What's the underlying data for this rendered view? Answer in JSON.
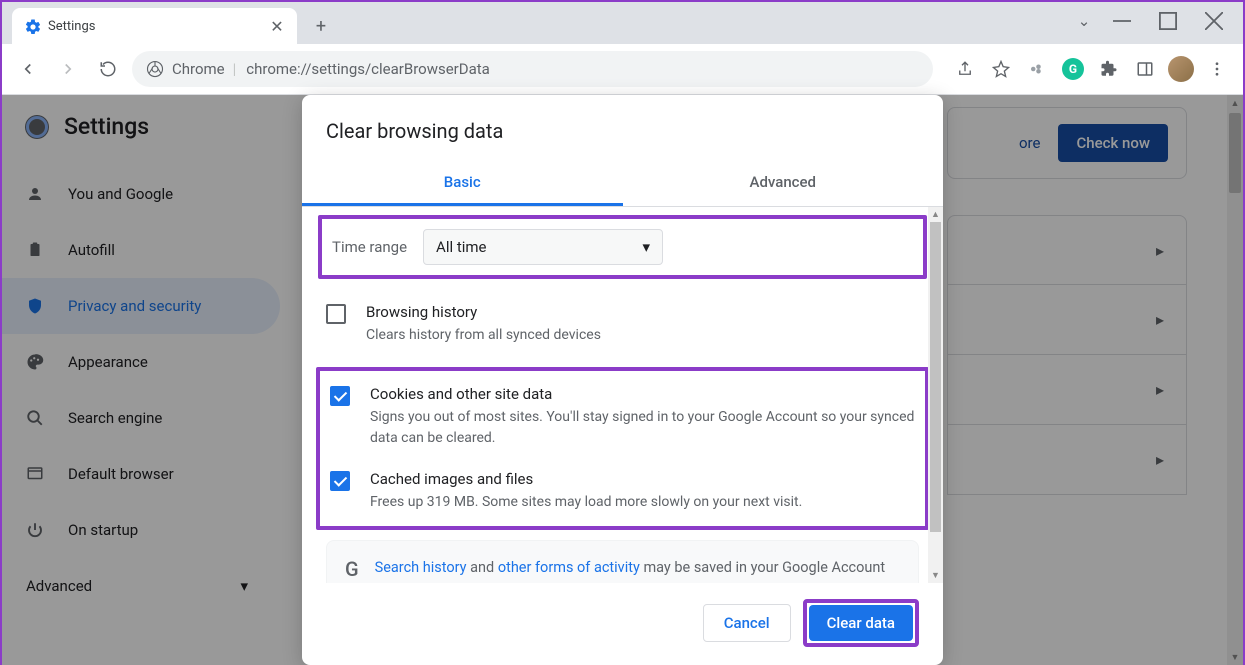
{
  "browser": {
    "tab_title": "Settings",
    "site_identity": "Chrome",
    "url": "chrome://settings/clearBrowserData",
    "safety_more": "ore",
    "check_now": "Check now"
  },
  "sidebar": {
    "title": "Settings",
    "items": [
      {
        "label": "You and Google"
      },
      {
        "label": "Autofill"
      },
      {
        "label": "Privacy and security"
      },
      {
        "label": "Appearance"
      },
      {
        "label": "Search engine"
      },
      {
        "label": "Default browser"
      },
      {
        "label": "On startup"
      }
    ],
    "advanced": "Advanced"
  },
  "dialog": {
    "title": "Clear browsing data",
    "tabs": {
      "basic": "Basic",
      "advanced": "Advanced"
    },
    "time_range": {
      "label": "Time range",
      "value": "All time"
    },
    "items": {
      "history": {
        "title": "Browsing history",
        "desc": "Clears history from all synced devices"
      },
      "cookies": {
        "title": "Cookies and other site data",
        "desc": "Signs you out of most sites. You'll stay signed in to your Google Account so your synced data can be cleared."
      },
      "cache": {
        "title": "Cached images and files",
        "desc": "Frees up 319 MB. Some sites may load more slowly on your next visit."
      }
    },
    "info": {
      "g": "G",
      "text_pre": "",
      "link1": "Search history",
      "mid1": " and ",
      "link2": "other forms of activity",
      "text_post": " may be saved in your Google Account when you're signed in. You can delete them anytime."
    },
    "buttons": {
      "cancel": "Cancel",
      "clear": "Clear data"
    }
  }
}
